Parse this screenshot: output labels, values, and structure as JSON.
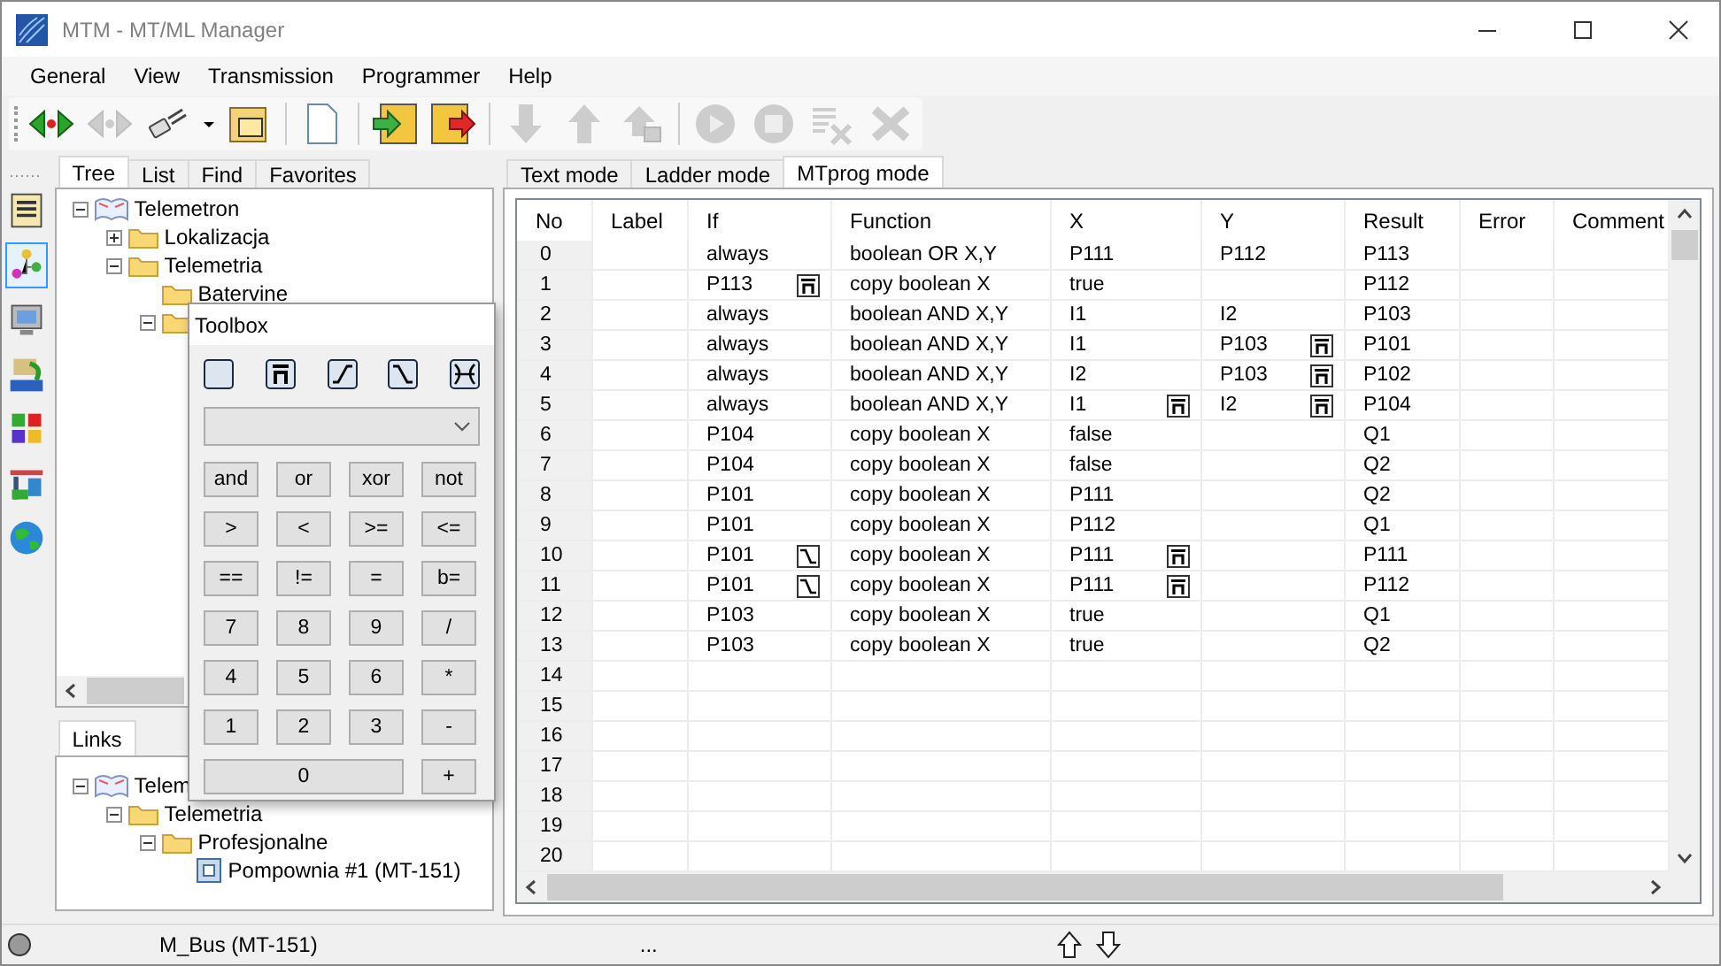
{
  "window": {
    "title": "MTM - MT/ML Manager"
  },
  "menu": [
    "General",
    "View",
    "Transmission",
    "Programmer",
    "Help"
  ],
  "toolbar": [
    {
      "kind": "connect",
      "disabled": false
    },
    {
      "kind": "connect",
      "disabled": true
    },
    {
      "kind": "plug",
      "disabled": false
    },
    {
      "kind": "caret",
      "disabled": false
    },
    {
      "kind": "folder",
      "disabled": false
    },
    {
      "kind": "separator"
    },
    {
      "kind": "page",
      "disabled": false
    },
    {
      "kind": "separator"
    },
    {
      "kind": "save-in",
      "disabled": false
    },
    {
      "kind": "save-out",
      "disabled": false
    },
    {
      "kind": "separator"
    },
    {
      "kind": "down",
      "disabled": true
    },
    {
      "kind": "up",
      "disabled": true
    },
    {
      "kind": "up-lock",
      "disabled": true
    },
    {
      "kind": "separator"
    },
    {
      "kind": "play",
      "disabled": true
    },
    {
      "kind": "stop",
      "disabled": true
    },
    {
      "kind": "clear",
      "disabled": true
    },
    {
      "kind": "delete",
      "disabled": true
    }
  ],
  "side_strip": [
    {
      "kind": "list",
      "selected": false
    },
    {
      "kind": "network",
      "selected": true
    },
    {
      "kind": "monitor",
      "selected": false
    },
    {
      "kind": "opc",
      "selected": false
    },
    {
      "kind": "blocks",
      "selected": false
    },
    {
      "kind": "station",
      "selected": false
    },
    {
      "kind": "globe",
      "selected": false
    }
  ],
  "left_tabs": [
    {
      "label": "Tree",
      "selected": true
    },
    {
      "label": "List",
      "selected": false
    },
    {
      "label": "Find",
      "selected": false
    },
    {
      "label": "Favorites",
      "selected": false
    }
  ],
  "tree": [
    {
      "label": "Telemetron",
      "kind": "root",
      "expanded": true,
      "children": [
        {
          "label": "Lokalizacja",
          "kind": "folder",
          "expanded": false
        },
        {
          "label": "Telemetria",
          "kind": "folder",
          "expanded": true,
          "children": [
            {
              "label": "Batervine",
              "kind": "folder"
            },
            {
              "kind": "folder",
              "expanded": true
            }
          ]
        }
      ]
    }
  ],
  "links_tab": {
    "label": "Links",
    "selected": true
  },
  "links_tree": [
    {
      "label": "Telem",
      "kind": "root",
      "expanded": true,
      "children": [
        {
          "label": "Telemetria",
          "kind": "folder",
          "expanded": true,
          "children": [
            {
              "label": "Profesjonalne",
              "kind": "folder",
              "expanded": true,
              "children": [
                {
                  "label": "Pompownia #1 (MT-151)",
                  "kind": "device"
                }
              ]
            }
          ]
        }
      ]
    }
  ],
  "toolbox": {
    "title": "Toolbox",
    "icons": [
      {
        "kind": "blank"
      },
      {
        "kind": "negation"
      },
      {
        "kind": "rising"
      },
      {
        "kind": "falling"
      },
      {
        "kind": "toggle"
      }
    ],
    "keys": [
      {
        "label": "and"
      },
      {
        "label": "or"
      },
      {
        "label": "xor"
      },
      {
        "label": "not"
      },
      {
        "label": ">"
      },
      {
        "label": "<"
      },
      {
        "label": ">="
      },
      {
        "label": "<="
      },
      {
        "label": "=="
      },
      {
        "label": "!="
      },
      {
        "label": "="
      },
      {
        "label": "b="
      },
      {
        "label": "7"
      },
      {
        "label": "8"
      },
      {
        "label": "9"
      },
      {
        "label": "/"
      },
      {
        "label": "4"
      },
      {
        "label": "5"
      },
      {
        "label": "6"
      },
      {
        "label": "*"
      },
      {
        "label": "1"
      },
      {
        "label": "2"
      },
      {
        "label": "3"
      },
      {
        "label": "-"
      },
      {
        "label": "0",
        "wide": true
      },
      {
        "label": "+"
      }
    ]
  },
  "right_tabs": [
    {
      "label": "Text mode",
      "selected": false
    },
    {
      "label": "Ladder mode",
      "selected": false
    },
    {
      "label": "MTprog mode",
      "selected": true
    }
  ],
  "table": {
    "columns": [
      "No",
      "Label",
      "If",
      "Function",
      "X",
      "Y",
      "Result",
      "Error",
      "Comment"
    ],
    "rows": [
      {
        "no": "0",
        "if": {
          "text": "always"
        },
        "function": "boolean OR X,Y",
        "x": {
          "text": "P111"
        },
        "y": {
          "text": "P112"
        },
        "result": "P113"
      },
      {
        "no": "1",
        "if": {
          "text": "P113",
          "kind": "negation"
        },
        "function": "copy boolean X",
        "x": {
          "text": "true"
        },
        "result": "P112"
      },
      {
        "no": "2",
        "if": {
          "text": "always"
        },
        "function": "boolean AND X,Y",
        "x": {
          "text": "I1"
        },
        "y": {
          "text": "I2"
        },
        "result": "P103"
      },
      {
        "no": "3",
        "if": {
          "text": "always"
        },
        "function": "boolean AND X,Y",
        "x": {
          "text": "I1"
        },
        "y": {
          "text": "P103",
          "kind": "negation"
        },
        "result": "P101"
      },
      {
        "no": "4",
        "if": {
          "text": "always"
        },
        "function": "boolean AND X,Y",
        "x": {
          "text": "I2"
        },
        "y": {
          "text": "P103",
          "kind": "negation"
        },
        "result": "P102"
      },
      {
        "no": "5",
        "if": {
          "text": "always"
        },
        "function": "boolean AND X,Y",
        "x": {
          "text": "I1",
          "kind": "negation"
        },
        "y": {
          "text": "I2",
          "kind": "negation"
        },
        "result": "P104"
      },
      {
        "no": "6",
        "if": {
          "text": "P104"
        },
        "function": "copy boolean X",
        "x": {
          "text": "false"
        },
        "result": "Q1"
      },
      {
        "no": "7",
        "if": {
          "text": "P104"
        },
        "function": "copy boolean X",
        "x": {
          "text": "false"
        },
        "result": "Q2"
      },
      {
        "no": "8",
        "if": {
          "text": "P101"
        },
        "function": "copy boolean X",
        "x": {
          "text": "P111"
        },
        "result": "Q2"
      },
      {
        "no": "9",
        "if": {
          "text": "P101"
        },
        "function": "copy boolean X",
        "x": {
          "text": "P112"
        },
        "result": "Q1"
      },
      {
        "no": "10",
        "if": {
          "text": "P101",
          "kind": "falling"
        },
        "function": "copy boolean X",
        "x": {
          "text": "P111",
          "kind": "negation"
        },
        "result": "P111"
      },
      {
        "no": "11",
        "if": {
          "text": "P101",
          "kind": "falling"
        },
        "function": "copy boolean X",
        "x": {
          "text": "P111",
          "kind": "negation"
        },
        "result": "P112"
      },
      {
        "no": "12",
        "if": {
          "text": "P103"
        },
        "function": "copy boolean X",
        "x": {
          "text": "true"
        },
        "result": "Q1"
      },
      {
        "no": "13",
        "if": {
          "text": "P103"
        },
        "function": "copy boolean X",
        "x": {
          "text": "true"
        },
        "result": "Q2"
      },
      {
        "no": "14"
      },
      {
        "no": "15"
      },
      {
        "no": "16"
      },
      {
        "no": "17"
      },
      {
        "no": "18"
      },
      {
        "no": "19"
      },
      {
        "no": "20"
      }
    ]
  },
  "status_bar": {
    "connection": "M_Bus (MT-151)",
    "info": "..."
  }
}
